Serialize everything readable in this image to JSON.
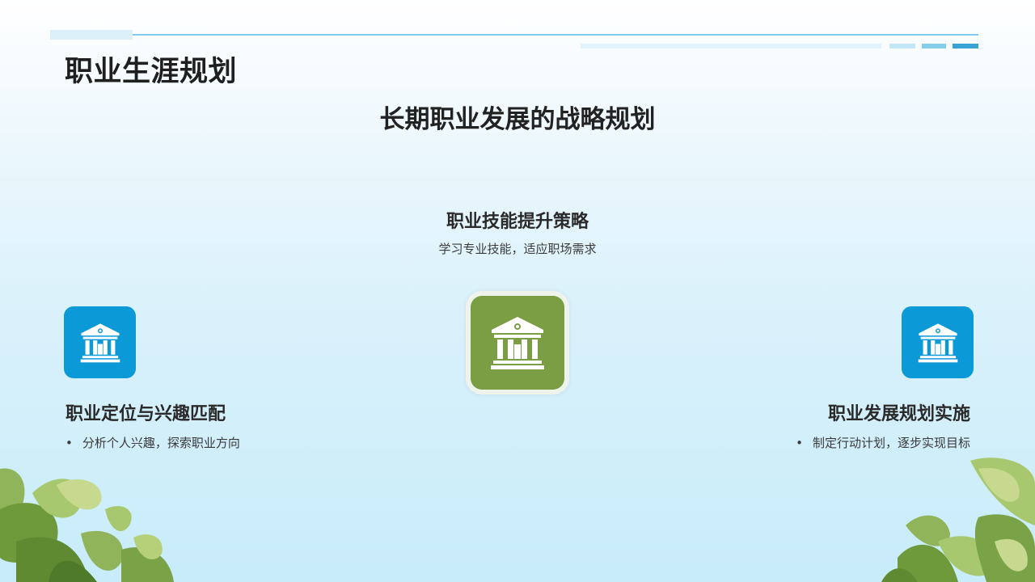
{
  "page_title": "职业生涯规划",
  "main_heading": "长期职业发展的战略规划",
  "center": {
    "title": "职业技能提升策略",
    "description": "学习专业技能，适应职场需求",
    "icon": "bank-icon"
  },
  "left": {
    "title": "职业定位与兴趣匹配",
    "bullet": "分析个人兴趣，探索职业方向",
    "icon": "bank-icon"
  },
  "right": {
    "title": "职业发展规划实施",
    "bullet": "制定行动计划，逐步实现目标",
    "icon": "bank-icon"
  },
  "bullet_char": "•",
  "colors": {
    "accent_blue": "#0b99d8",
    "accent_green": "#7b9e44",
    "title_text": "#1f1f1f",
    "body_text": "#3a3a3a"
  }
}
